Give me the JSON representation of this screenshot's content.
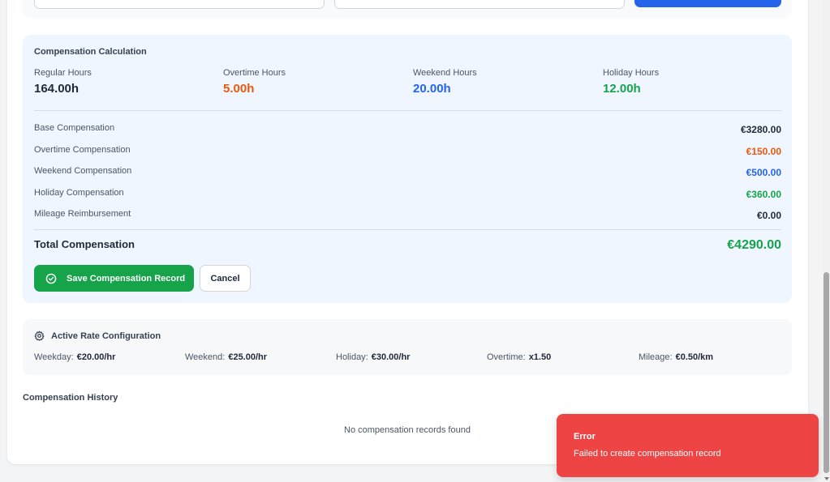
{
  "colors": {
    "overtime": "#ea580c",
    "weekend": "#2563eb",
    "holiday": "#16a34a",
    "neutral": "#1f2937",
    "toast": "#ef4444"
  },
  "calculation": {
    "title": "Compensation Calculation",
    "hours": [
      {
        "label": "Regular Hours",
        "value": "164.00h",
        "color": "#1f2937"
      },
      {
        "label": "Overtime Hours",
        "value": "5.00h",
        "color": "#ea580c"
      },
      {
        "label": "Weekend Hours",
        "value": "20.00h",
        "color": "#2563eb"
      },
      {
        "label": "Holiday Hours",
        "value": "12.00h",
        "color": "#16a34a"
      }
    ],
    "lines": [
      {
        "label": "Base Compensation",
        "value": "€3280.00",
        "color": "#1f2937"
      },
      {
        "label": "Overtime Compensation",
        "value": "€150.00",
        "color": "#ea580c"
      },
      {
        "label": "Weekend Compensation",
        "value": "€500.00",
        "color": "#2563eb"
      },
      {
        "label": "Holiday Compensation",
        "value": "€360.00",
        "color": "#16a34a"
      },
      {
        "label": "Mileage Reimbursement",
        "value": "€0.00",
        "color": "#1f2937"
      }
    ],
    "total_label": "Total Compensation",
    "total_value": "€4290.00",
    "save_label": "Save Compensation Record",
    "cancel_label": "Cancel"
  },
  "rates": {
    "title": "Active Rate Configuration",
    "items": [
      {
        "label": "Weekday:",
        "value": "€20.00/hr"
      },
      {
        "label": "Weekend:",
        "value": "€25.00/hr"
      },
      {
        "label": "Holiday:",
        "value": "€30.00/hr"
      },
      {
        "label": "Overtime:",
        "value": "x1.50"
      },
      {
        "label": "Mileage:",
        "value": "€0.50/km"
      }
    ]
  },
  "history": {
    "title": "Compensation History",
    "empty_text": "No compensation records found"
  },
  "toast": {
    "title": "Error",
    "message": "Failed to create compensation record"
  }
}
